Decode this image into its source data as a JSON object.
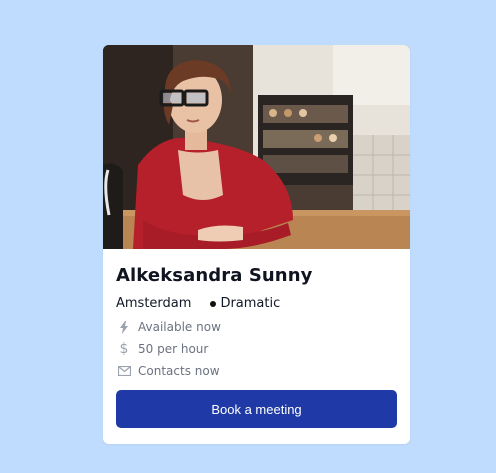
{
  "card": {
    "name": "Alkeksandra Sunny",
    "city": "Amsterdam",
    "genre": "Dramatic",
    "availability": "Available now",
    "rate": "50 per hour",
    "contacts": "Contacts now",
    "cta": "Book a meeting"
  },
  "icons": {
    "availability": "bolt-icon",
    "rate": "dollar-icon",
    "contacts": "envelope-icon"
  },
  "colors": {
    "background": "#bfdcff",
    "button": "#1f3aa6",
    "muted_text": "#6b7280"
  }
}
